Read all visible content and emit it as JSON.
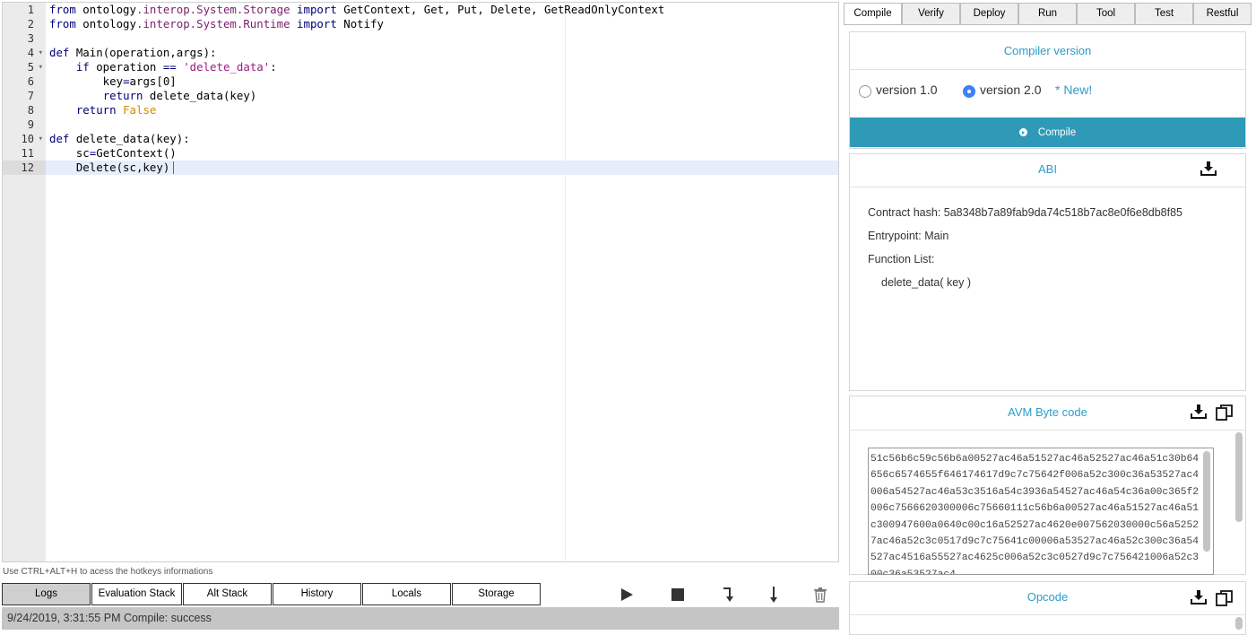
{
  "editor": {
    "lines": [
      {
        "num": "1",
        "fold": false,
        "segments": [
          {
            "t": "kw",
            "v": "from"
          },
          {
            "t": "",
            "v": " ontology"
          },
          {
            "t": "ns",
            "v": ".interop.System.Storage"
          },
          {
            "t": "",
            "v": " "
          },
          {
            "t": "kw",
            "v": "import"
          },
          {
            "t": "",
            "v": " GetContext, Get, Put, Delete, GetReadOnlyContext"
          }
        ]
      },
      {
        "num": "2",
        "fold": false,
        "segments": [
          {
            "t": "kw",
            "v": "from"
          },
          {
            "t": "",
            "v": " ontology"
          },
          {
            "t": "ns",
            "v": ".interop.System.Runtime"
          },
          {
            "t": "",
            "v": " "
          },
          {
            "t": "kw",
            "v": "import"
          },
          {
            "t": "",
            "v": " Notify"
          }
        ]
      },
      {
        "num": "3",
        "fold": false,
        "segments": []
      },
      {
        "num": "4",
        "fold": true,
        "segments": [
          {
            "t": "kw",
            "v": "def"
          },
          {
            "t": "",
            "v": " Main(operation,args):"
          }
        ]
      },
      {
        "num": "5",
        "fold": true,
        "segments": [
          {
            "t": "",
            "v": "    "
          },
          {
            "t": "kw",
            "v": "if"
          },
          {
            "t": "",
            "v": " operation "
          },
          {
            "t": "kw",
            "v": "=="
          },
          {
            "t": "",
            "v": " "
          },
          {
            "t": "str",
            "v": "'delete_data'"
          },
          {
            "t": "",
            "v": ":"
          }
        ]
      },
      {
        "num": "6",
        "fold": false,
        "segments": [
          {
            "t": "",
            "v": "        key"
          },
          {
            "t": "kw",
            "v": "="
          },
          {
            "t": "",
            "v": "args[0]"
          }
        ]
      },
      {
        "num": "7",
        "fold": false,
        "segments": [
          {
            "t": "",
            "v": "        "
          },
          {
            "t": "kw",
            "v": "return"
          },
          {
            "t": "",
            "v": " delete_data(key)"
          }
        ]
      },
      {
        "num": "8",
        "fold": false,
        "segments": [
          {
            "t": "",
            "v": "    "
          },
          {
            "t": "kw",
            "v": "return"
          },
          {
            "t": "",
            "v": " "
          },
          {
            "t": "bool",
            "v": "False"
          }
        ]
      },
      {
        "num": "9",
        "fold": false,
        "segments": []
      },
      {
        "num": "10",
        "fold": true,
        "segments": [
          {
            "t": "kw",
            "v": "def"
          },
          {
            "t": "",
            "v": " delete_data(key):"
          }
        ]
      },
      {
        "num": "11",
        "fold": false,
        "segments": [
          {
            "t": "",
            "v": "    sc"
          },
          {
            "t": "kw",
            "v": "="
          },
          {
            "t": "",
            "v": "GetContext()"
          }
        ]
      },
      {
        "num": "12",
        "fold": false,
        "active": true,
        "segments": [
          {
            "t": "",
            "v": "    Delete(sc,key)"
          }
        ]
      }
    ]
  },
  "hint": "Use CTRL+ALT+H to acess the hotkeys informations",
  "bottom_tabs": [
    {
      "label": "Logs",
      "active": true
    },
    {
      "label": "Evaluation Stack",
      "active": false
    },
    {
      "label": "Alt Stack",
      "active": false
    },
    {
      "label": "History",
      "active": false
    },
    {
      "label": "Locals",
      "active": false
    },
    {
      "label": "Storage",
      "active": false
    }
  ],
  "controls": [
    "play-icon",
    "stop-icon",
    "step-over-icon",
    "step-into-icon",
    "trash-icon"
  ],
  "log": {
    "text": "9/24/2019, 3:31:55 PM Compile: success"
  },
  "right_tabs": [
    {
      "label": "Compile",
      "active": true
    },
    {
      "label": "Verify",
      "active": false
    },
    {
      "label": "Deploy",
      "active": false
    },
    {
      "label": "Run",
      "active": false
    },
    {
      "label": "Tool",
      "active": false
    },
    {
      "label": "Test",
      "active": false
    },
    {
      "label": "Restful",
      "active": false
    }
  ],
  "compiler": {
    "title": "Compiler version",
    "option1": "version 1.0",
    "option2": "version 2.0",
    "option2_badge": "* New!",
    "selected": "version 2.0",
    "button": "Compile"
  },
  "abi": {
    "title": "ABI",
    "contract_hash": "Contract hash: 5a8348b7a89fab9da74c518b7ac8e0f6e8db8f85",
    "entrypoint": "Entrypoint: Main",
    "function_list_label": "Function List:",
    "function": "delete_data( key )"
  },
  "avm": {
    "title": "AVM Byte code",
    "code": "51c56b6c59c56b6a00527ac46a51527ac46a52527ac46a51c30b64656c6574655f646174617d9c7c75642f006a52c300c36a53527ac4006a54527ac46a53c3516a54c3936a54527ac46a54c36a00c365f2006c7566620300006c75660111c56b6a00527ac46a51527ac46a51c300947600a0640c00c16a52527ac4620e007562030000c56a52527ac46a52c3c0517d9c7c75641c00006a53527ac46a52c300c36a54527ac4516a55527ac4625c006a52c3c0527d9c7c756421006a52c300c36a53527ac4"
  },
  "opcode": {
    "title": "Opcode"
  },
  "colors": {
    "accent": "#2d9cc7",
    "button": "#2f9ab8",
    "log_bar": "#c5c5c5"
  }
}
